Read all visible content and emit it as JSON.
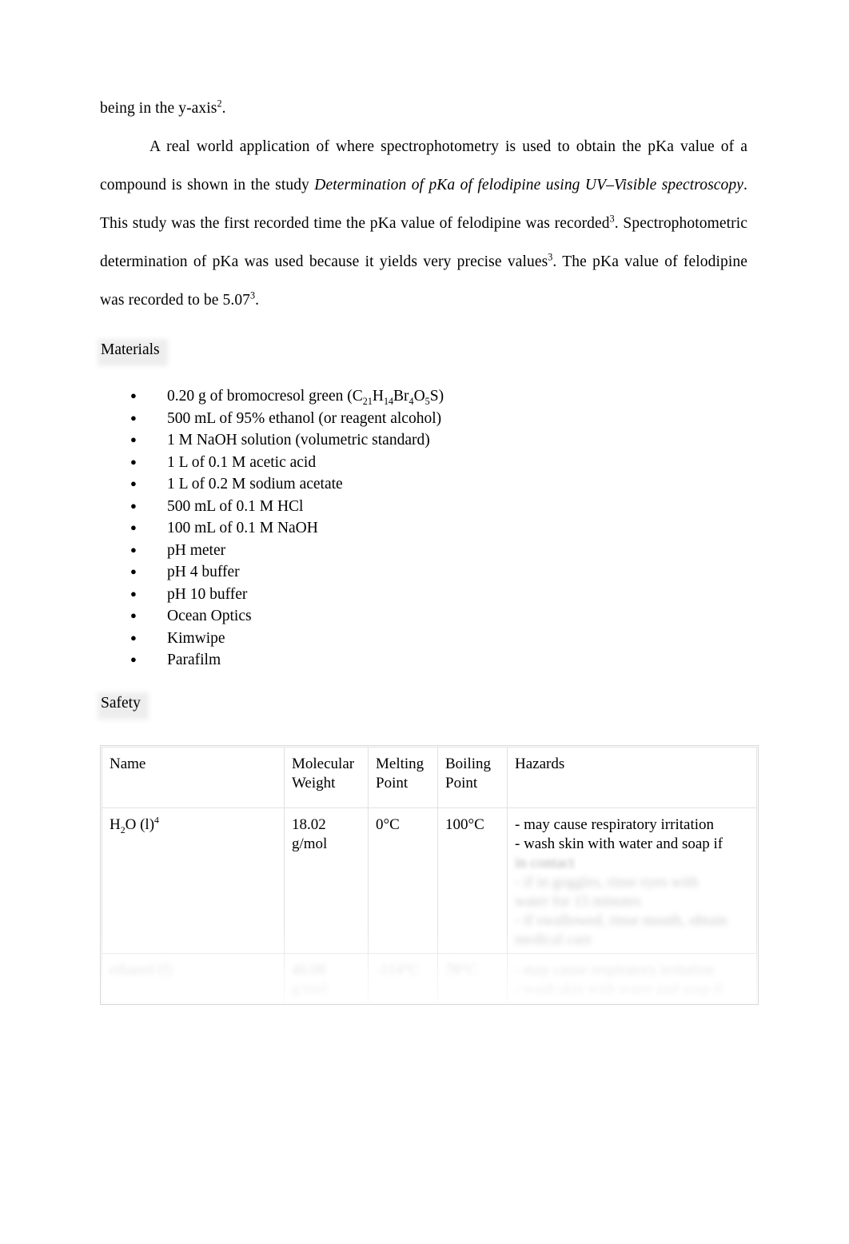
{
  "document": {
    "paragraphs": [
      {
        "id": "p-yaxis",
        "text_before": "being in the y-axis",
        "sup": "2",
        "text_after": "."
      }
    ],
    "para_real_world": {
      "lead": "A real world application of where spectrophotometry is used to obtain the pKa value of a compound is shown in the study ",
      "italic_title": "Determination of pKa of felodipine using UV–Visible spectroscopy",
      "after_title": ". This study was the first recorded time the pKa value of felodipine was recorded",
      "sup1": "3",
      "mid": ". Spectrophotometric determination of pKa was used because it yields very precise values",
      "sup2": "3",
      "tail": ". The pKa value of felodipine was recorded to be 5.07",
      "sup3": "3",
      "end": "."
    },
    "headings": {
      "materials": "Materials",
      "safety": "Safety"
    },
    "materials_list": [
      {
        "prefix": "0.20 g of bromocresol green (C",
        "formula": [
          [
            "21",
            "H"
          ],
          [
            "14",
            "Br"
          ],
          [
            "4",
            "O"
          ],
          [
            "5",
            "S"
          ]
        ],
        "suffix": ")",
        "plain": "0.20 g of bromocresol green (C21H14Br4O5S)"
      },
      {
        "plain": "500 mL of 95% ethanol (or reagent alcohol)"
      },
      {
        "plain": "1 M NaOH solution (volumetric standard)"
      },
      {
        "plain": "1 L of 0.1 M acetic acid"
      },
      {
        "plain": "1 L of 0.2 M sodium acetate"
      },
      {
        "plain": "500 mL of 0.1 M HCl"
      },
      {
        "plain": "100 mL of 0.1 M NaOH"
      },
      {
        "plain": "pH meter"
      },
      {
        "plain": "pH 4 buffer"
      },
      {
        "plain": "pH 10 buffer"
      },
      {
        "plain": "Ocean Optics"
      },
      {
        "plain": "Kimwipe"
      },
      {
        "plain": "Parafilm"
      }
    ],
    "safety_table": {
      "headers": {
        "name": "Name",
        "molecular_weight": "Molecular Weight",
        "melting_point": "Melting Point",
        "boiling_point": "Boiling Point",
        "hazards": "Hazards"
      },
      "rows": [
        {
          "name_base": "H",
          "name_sub": "2",
          "name_mid": "O (l)",
          "name_sup": "4",
          "name_plain": "H2O (l)4",
          "molecular_weight": "18.02 g/mol",
          "melting_point": "0°C",
          "boiling_point": "100°C",
          "hazards_visible": [
            "- may cause respiratory irritation",
            "- wash skin with water and soap if"
          ],
          "hazards_obscured": [
            "in contact",
            "- if in goggles, rinse eyes with",
            "water for 15 minutes",
            "- if swallowed, rinse mouth, obtain",
            "medical care"
          ]
        },
        {
          "name_plain": "ethanol (l)",
          "molecular_weight": "46.08 g/mol",
          "melting_point": "-114°C",
          "boiling_point": "78°C",
          "hazards_obscured": [
            "- may cause respiratory irritation",
            "- wash skin with water and soap if"
          ],
          "obscured": true
        }
      ]
    }
  }
}
